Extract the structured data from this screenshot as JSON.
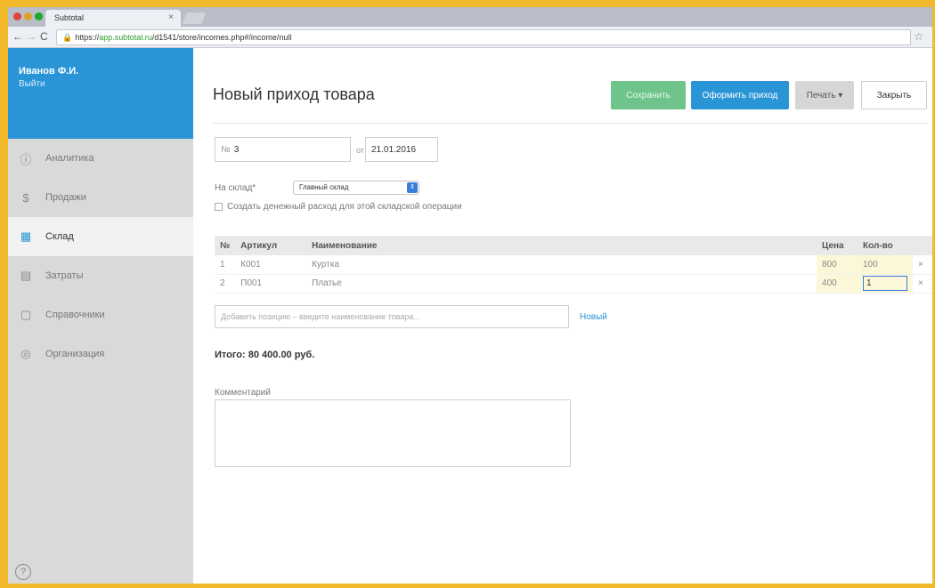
{
  "browser": {
    "tab_title": "Subtotal",
    "tab_close": "×",
    "url_protocol": "https://",
    "url_host": "app.subtotal.ru",
    "url_path": "/d1541/store/incomes.php#/income/null",
    "lock_glyph": "🔒",
    "back": "←",
    "forward": "→",
    "reload": "C",
    "bookmark": "☆"
  },
  "sidebar": {
    "user_name": "Иванов Ф.И.",
    "user_exit": "Выйти",
    "items": [
      {
        "label": "Аналитика",
        "icon": "analytics-icon",
        "glyph": "ⓘ",
        "active": false
      },
      {
        "label": "Продажи",
        "icon": "sales-icon",
        "glyph": "$",
        "active": false
      },
      {
        "label": "Склад",
        "icon": "warehouse-icon",
        "glyph": "▦",
        "active": true
      },
      {
        "label": "Затраты",
        "icon": "expenses-icon",
        "glyph": "▤",
        "active": false
      },
      {
        "label": "Справочники",
        "icon": "reference-icon",
        "glyph": "▢",
        "active": false
      },
      {
        "label": "Организация",
        "icon": "organization-icon",
        "glyph": "◎",
        "active": false
      }
    ],
    "help": "?"
  },
  "page": {
    "title": "Новый приход товара",
    "buttons": {
      "save": "Сохранить",
      "post": "Оформить приход",
      "print": "Печать ▾",
      "close": "Закрыть"
    },
    "number_prefix": "№",
    "number_value": "3",
    "from_label": "от",
    "date_value": "21.01.2016",
    "warehouse_label": "На склад*",
    "warehouse_value": "Главный склад",
    "warehouse_arrow": "⇕",
    "create_expense_label": "Создать денежный расход для этой складской операции"
  },
  "table": {
    "headers": [
      "№",
      "Артикул",
      "Наименование",
      "Цена",
      "Кол-во"
    ],
    "rows": [
      {
        "num": "1",
        "sku": "К001",
        "name": "Куртка",
        "price": "800",
        "qty": "100"
      },
      {
        "num": "2",
        "sku": "П001",
        "name": "Платье",
        "price": "400",
        "qty": "1"
      }
    ],
    "remove_glyph": "×"
  },
  "add_position": {
    "placeholder": "Добавить позицию – введите наименование товара...",
    "new_link": "Новый"
  },
  "total": "Итого: 80 400.00 руб.",
  "comment_label": "Комментарий",
  "colors": {
    "accent": "#2a95d6",
    "save_green": "#6fc48b",
    "sidebar_bg": "#d9d9d9",
    "outer_border": "#f2b92a"
  }
}
